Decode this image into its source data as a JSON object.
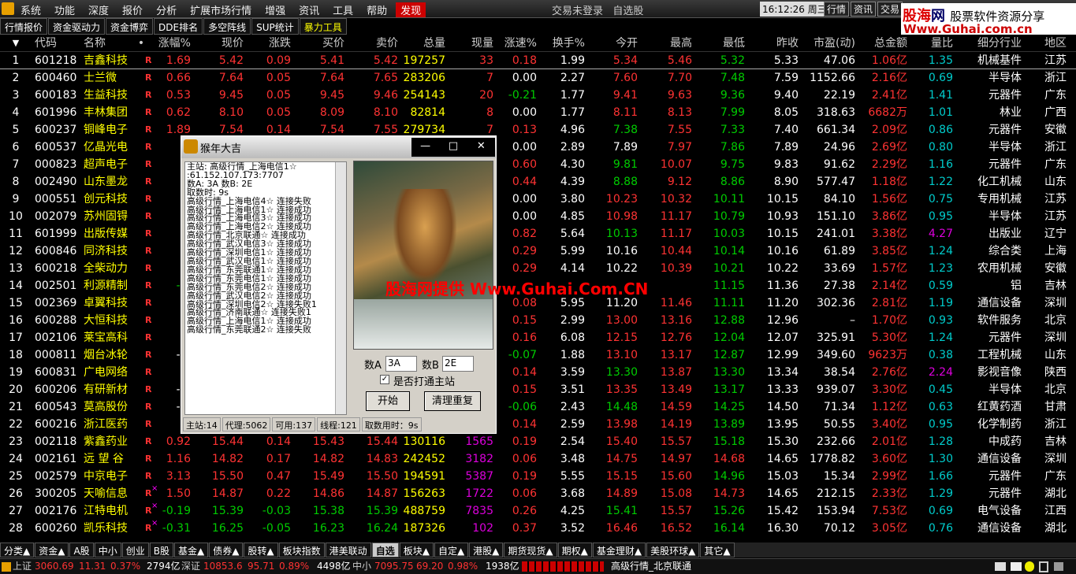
{
  "menubar": {
    "items": [
      "系统",
      "功能",
      "深度",
      "报价",
      "分析",
      "扩展市场行情",
      "增强",
      "资讯",
      "工具",
      "帮助",
      "发现"
    ],
    "login_status": "交易未登录",
    "watchlist_label": "自选股",
    "clock": "16:12:26 周三",
    "right_buttons": [
      "行情",
      "资讯",
      "交易"
    ]
  },
  "banner": {
    "line1_a": "股海",
    "line1_b": "网",
    "line1_c": "股票软件资源分享",
    "line2": "Www.Guhai.com.cn"
  },
  "toolbar": {
    "tabs": [
      "行情报价",
      "资金驱动力",
      "资金博弈",
      "DDE排名",
      "多空阵线",
      "SUP统计",
      "暴力工具"
    ]
  },
  "table": {
    "sort_icon": "▼",
    "headers": [
      "代码",
      "名称",
      "•",
      "涨幅%",
      "现价",
      "涨跌",
      "买价",
      "卖价",
      "总量",
      "现量",
      "涨速%",
      "换手%",
      "今开",
      "最高",
      "最低",
      "昨收",
      "市盈(动)",
      "总金额",
      "量比",
      "细分行业",
      "地区"
    ],
    "rows": [
      [
        "1",
        "601218",
        "吉鑫科技",
        "1.69",
        "5.42",
        "0.09",
        "5.41",
        "5.42",
        "197257",
        "33",
        "0.18",
        "1.99",
        "5.34",
        "5.46",
        "5.32",
        "5.33",
        "47.06",
        "1.06亿",
        "1.35",
        "机械基件",
        "江苏"
      ],
      [
        "2",
        "600460",
        "士兰微",
        "0.66",
        "7.64",
        "0.05",
        "7.64",
        "7.65",
        "283206",
        "7",
        "0.00",
        "2.27",
        "7.60",
        "7.70",
        "7.48",
        "7.59",
        "1152.66",
        "2.16亿",
        "0.69",
        "半导体",
        "浙江"
      ],
      [
        "3",
        "600183",
        "生益科技",
        "0.53",
        "9.45",
        "0.05",
        "9.45",
        "9.46",
        "254143",
        "20",
        "-0.21",
        "1.77",
        "9.41",
        "9.63",
        "9.36",
        "9.40",
        "22.19",
        "2.41亿",
        "1.41",
        "元器件",
        "广东"
      ],
      [
        "4",
        "601996",
        "丰林集团",
        "0.62",
        "8.10",
        "0.05",
        "8.09",
        "8.10",
        "82814",
        "8",
        "0.00",
        "1.77",
        "8.11",
        "8.13",
        "7.99",
        "8.05",
        "318.63",
        "6682万",
        "1.01",
        "林业",
        "广西"
      ],
      [
        "5",
        "600237",
        "铜峰电子",
        "1.89",
        "7.54",
        "0.14",
        "7.54",
        "7.55",
        "279734",
        "7",
        "0.13",
        "4.96",
        "7.38",
        "7.55",
        "7.33",
        "7.40",
        "661.34",
        "2.09亿",
        "0.86",
        "元器件",
        "安徽"
      ],
      [
        "6",
        "600537",
        "亿晶光电",
        "0.",
        "",
        "",
        "",
        "",
        "",
        "",
        "0.00",
        "2.89",
        "7.89",
        "7.97",
        "7.86",
        "7.89",
        "24.96",
        "2.69亿",
        "0.80",
        "半导体",
        "浙江"
      ],
      [
        "7",
        "000823",
        "超声电子",
        "2.",
        "",
        "",
        "",
        "",
        "",
        "",
        "0.60",
        "4.30",
        "9.81",
        "10.07",
        "9.75",
        "9.83",
        "91.62",
        "2.29亿",
        "1.16",
        "元器件",
        "广东"
      ],
      [
        "8",
        "002490",
        "山东墨龙",
        "1.",
        "",
        "",
        "",
        "",
        "",
        "",
        "0.44",
        "4.39",
        "8.88",
        "9.12",
        "8.86",
        "8.90",
        "577.47",
        "1.18亿",
        "1.22",
        "化工机械",
        "山东"
      ],
      [
        "9",
        "000551",
        "创元科技",
        "0.",
        "",
        "",
        "",
        "",
        "",
        "",
        "0.00",
        "3.80",
        "10.23",
        "10.32",
        "10.11",
        "10.15",
        "84.10",
        "1.56亿",
        "0.75",
        "专用机械",
        "江苏"
      ],
      [
        "10",
        "002079",
        "苏州固锝",
        "0.",
        "",
        "",
        "",
        "",
        "",
        "",
        "0.00",
        "4.85",
        "10.98",
        "11.17",
        "10.79",
        "10.93",
        "151.10",
        "3.86亿",
        "0.95",
        "半导体",
        "江苏"
      ],
      [
        "11",
        "601999",
        "出版传媒",
        "8.",
        "",
        "",
        "",
        "",
        "",
        "",
        "0.82",
        "5.64",
        "10.13",
        "11.17",
        "10.03",
        "10.15",
        "241.01",
        "3.38亿",
        "4.27",
        "出版业",
        "辽宁"
      ],
      [
        "12",
        "600846",
        "同济科技",
        "0.",
        "",
        "",
        "",
        "",
        "",
        "",
        "0.29",
        "5.99",
        "10.16",
        "10.44",
        "10.14",
        "10.16",
        "61.89",
        "3.85亿",
        "1.24",
        "综合类",
        "上海"
      ],
      [
        "13",
        "600218",
        "全柴动力",
        "0.",
        "",
        "",
        "",
        "",
        "",
        "",
        "0.29",
        "4.14",
        "10.22",
        "10.39",
        "10.21",
        "10.22",
        "33.69",
        "1.57亿",
        "1.23",
        "农用机械",
        "安徽"
      ],
      [
        "14",
        "002501",
        "利源精制",
        "-1.",
        "",
        "",
        "",
        "",
        "",
        "",
        "",
        "",
        "",
        "",
        "11.15",
        "11.36",
        "27.38",
        "2.14亿",
        "0.59",
        "铝",
        "吉林"
      ],
      [
        "15",
        "002369",
        "卓翼科技",
        "1.",
        "",
        "",
        "",
        "",
        "",
        "",
        "0.08",
        "5.95",
        "11.20",
        "11.46",
        "11.11",
        "11.20",
        "302.36",
        "2.81亿",
        "1.19",
        "通信设备",
        "深圳"
      ],
      [
        "16",
        "600288",
        "大恒科技",
        "1.",
        "",
        "",
        "",
        "",
        "",
        "",
        "0.15",
        "2.99",
        "13.00",
        "13.16",
        "12.88",
        "12.96",
        "–",
        "1.70亿",
        "0.93",
        "软件服务",
        "北京"
      ],
      [
        "17",
        "002106",
        "莱宝高科",
        "2.",
        "",
        "",
        "",
        "",
        "",
        "",
        "0.16",
        "6.08",
        "12.15",
        "12.76",
        "12.04",
        "12.07",
        "325.91",
        "5.30亿",
        "1.24",
        "元器件",
        "深圳"
      ],
      [
        "18",
        "000811",
        "烟台冰轮",
        "-0.",
        "",
        "",
        "",
        "",
        "",
        "",
        "-0.07",
        "1.88",
        "13.10",
        "13.17",
        "12.87",
        "12.99",
        "349.60",
        "9623万",
        "0.38",
        "工程机械",
        "山东"
      ],
      [
        "19",
        "600831",
        "广电网络",
        "0.",
        "",
        "",
        "",
        "",
        "",
        "",
        "0.14",
        "3.59",
        "13.30",
        "13.87",
        "13.30",
        "13.34",
        "38.54",
        "2.76亿",
        "2.24",
        "影视音像",
        "陕西"
      ],
      [
        "20",
        "600206",
        "有研新材",
        "-0.",
        "",
        "",
        "",
        "",
        "",
        "",
        "0.15",
        "3.51",
        "13.35",
        "13.49",
        "13.17",
        "13.33",
        "939.07",
        "3.30亿",
        "0.45",
        "半导体",
        "北京"
      ],
      [
        "21",
        "600543",
        "莫高股份",
        "-0.",
        "",
        "",
        "",
        "",
        "",
        "",
        "-0.06",
        "2.43",
        "14.48",
        "14.59",
        "14.25",
        "14.50",
        "71.34",
        "1.12亿",
        "0.63",
        "红黄药酒",
        "甘肃"
      ],
      [
        "22",
        "600216",
        "浙江医药",
        "0.",
        "",
        "",
        "",
        "",
        "",
        "",
        "0.14",
        "2.59",
        "13.98",
        "14.19",
        "13.89",
        "13.95",
        "50.55",
        "3.40亿",
        "0.95",
        "化学制药",
        "浙江"
      ],
      [
        "23",
        "002118",
        "紫鑫药业",
        "0.92",
        "15.44",
        "0.14",
        "15.43",
        "15.44",
        "130116",
        "1565",
        "0.19",
        "2.54",
        "15.40",
        "15.57",
        "15.18",
        "15.30",
        "232.66",
        "2.01亿",
        "1.28",
        "中成药",
        "吉林"
      ],
      [
        "24",
        "002161",
        "远 望 谷",
        "1.16",
        "14.82",
        "0.17",
        "14.82",
        "14.83",
        "242452",
        "3182",
        "0.06",
        "3.48",
        "14.75",
        "14.97",
        "14.68",
        "14.65",
        "1778.82",
        "3.60亿",
        "1.30",
        "通信设备",
        "深圳"
      ],
      [
        "25",
        "002579",
        "中京电子",
        "3.13",
        "15.50",
        "0.47",
        "15.49",
        "15.50",
        "194591",
        "5387",
        "0.19",
        "5.55",
        "15.15",
        "15.60",
        "14.96",
        "15.03",
        "15.34",
        "2.99亿",
        "1.66",
        "元器件",
        "广东"
      ],
      [
        "26",
        "300205",
        "天喻信息",
        "1.50",
        "14.87",
        "0.22",
        "14.86",
        "14.87",
        "156263",
        "1722",
        "0.06",
        "3.68",
        "14.89",
        "15.08",
        "14.73",
        "14.65",
        "212.15",
        "2.33亿",
        "1.29",
        "元器件",
        "湖北"
      ],
      [
        "27",
        "002176",
        "江特电机",
        "-0.19",
        "15.39",
        "-0.03",
        "15.38",
        "15.39",
        "488759",
        "7835",
        "0.26",
        "4.25",
        "15.41",
        "15.57",
        "15.26",
        "15.42",
        "153.94",
        "7.53亿",
        "0.69",
        "电气设备",
        "江西"
      ],
      [
        "28",
        "600260",
        "凯乐科技",
        "-0.31",
        "16.25",
        "-0.05",
        "16.23",
        "16.24",
        "187326",
        "102",
        "0.37",
        "3.52",
        "16.46",
        "16.52",
        "16.14",
        "16.30",
        "70.12",
        "3.05亿",
        "0.76",
        "通信设备",
        "湖北"
      ]
    ]
  },
  "dialog": {
    "title": "猴年大吉",
    "win_buttons": [
      "—",
      "□",
      "✕"
    ],
    "log": [
      "主站: 高级行情_上海电信1☆",
      ":61.152.107.173:7707",
      "数A: 3A  数B: 2E",
      "取数时: 9s",
      "高级行情_上海电信4☆  连接失败",
      "高级行情_上海电信1☆  连接成功",
      "高级行情_上海电信3☆  连接成功",
      "高级行情_上海电信2☆  连接成功",
      "高级行情_北京联通☆  连接成功",
      "高级行情_武汉电信3☆  连接成功",
      "高级行情_深圳电信1☆  连接成功",
      "高级行情_武汉电信1☆  连接成功",
      "高级行情_东莞联通1☆  连接成功",
      "高级行情_东莞电信1☆  连接成功",
      "高级行情_东莞电信2☆  连接成功",
      "高级行情_武汉电信2☆  连接成功",
      "高级行情_深圳电信2☆  连接失败1",
      "高级行情_济南联通☆  连接失败1",
      "高级行情_上海电信1☆  连接成功",
      "高级行情_东莞联通2☆  连接失败"
    ],
    "field_a_label": "数A",
    "field_a_value": "3A",
    "field_b_label": "数B",
    "field_b_value": "2E",
    "checkbox_label": "是否打通主站",
    "checkbox_mark": "✓",
    "start_button": "开始",
    "clear_button": "清理重复",
    "status": [
      "主站:14",
      "代理:5062",
      "可用:137",
      "线程:121",
      "取数用时：9s"
    ]
  },
  "watermark": "股海网提供 Www.Guhai.Com.CN",
  "bottom_tabs": [
    "分类▲",
    "资金▲",
    "A股",
    "中小",
    "创业",
    "B股",
    "基金▲",
    "债券▲",
    "股转▲",
    "板块指数",
    "港美联动",
    "自选",
    "板块▲",
    "自定▲",
    "港股▲",
    "期货现货▲",
    "期权▲",
    "基金理财▲",
    "美股环球▲",
    "其它▲"
  ],
  "statusbar": {
    "sh_label": "上证",
    "sh_val": "3060.69",
    "sh_chg": "11.31",
    "sh_pct": "0.37%",
    "sh_amt": "2794亿",
    "sz_label": "深证",
    "sz_val": "10853.6",
    "sz_chg": "95.71",
    "sz_pct": "0.89%",
    "sz_amt": "4498亿",
    "zx_label": "中小",
    "zx_val": "7095.75",
    "zx_chg": "69.20",
    "zx_pct": "0.98%",
    "zx_amt": "1938亿",
    "server": "高级行情_北京联通"
  },
  "colors": {
    "up": "#ff3333",
    "down": "#00cc00",
    "yellow": "#ffff00",
    "magenta": "#dd00dd",
    "cyan": "#00cccc"
  }
}
